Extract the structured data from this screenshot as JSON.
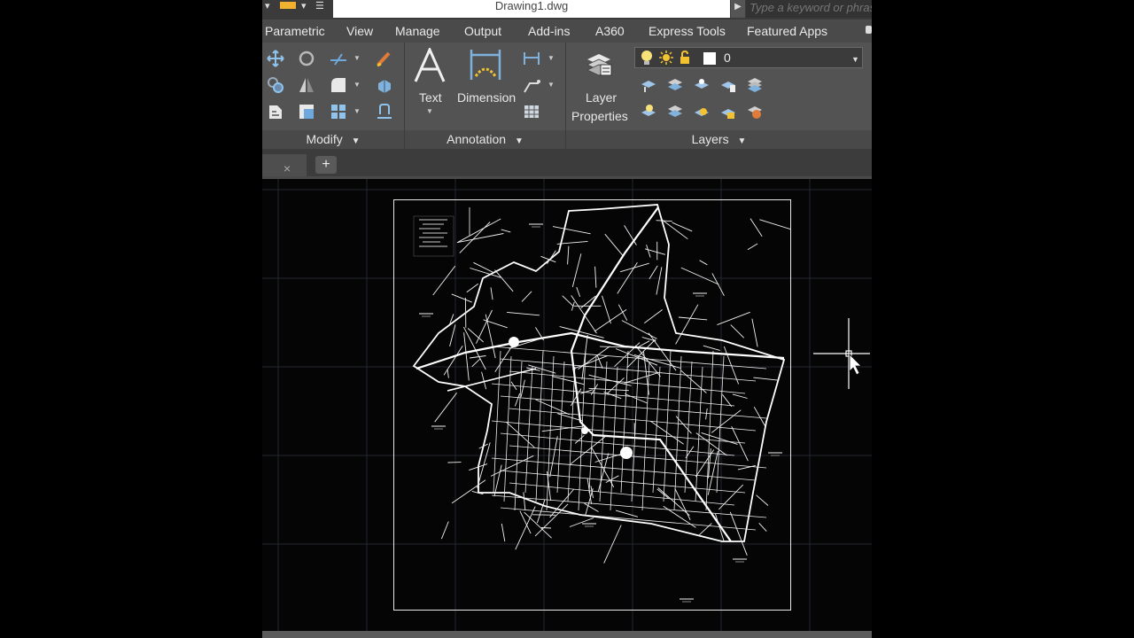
{
  "titlebar": {
    "document_title": "Drawing1.dwg",
    "search_placeholder": "Type a keyword or phrase"
  },
  "ribbon_tabs": [
    "Parametric",
    "View",
    "Manage",
    "Output",
    "Add-ins",
    "A360",
    "Express Tools",
    "Featured Apps"
  ],
  "ribbon": {
    "modify": {
      "title": "Modify"
    },
    "annotation": {
      "title": "Annotation",
      "text_label": "Text",
      "dimension_label": "Dimension"
    },
    "layers": {
      "title": "Layers",
      "layer_properties_label_line1": "Layer",
      "layer_properties_label_line2": "Properties",
      "current_layer": "0"
    }
  },
  "file_tabs": {
    "close_glyph": "×",
    "new_glyph": "+"
  },
  "colors": {
    "accent_yellow": "#f2c230",
    "ribbon_bg": "#535353",
    "canvas_bg": "#050505"
  }
}
